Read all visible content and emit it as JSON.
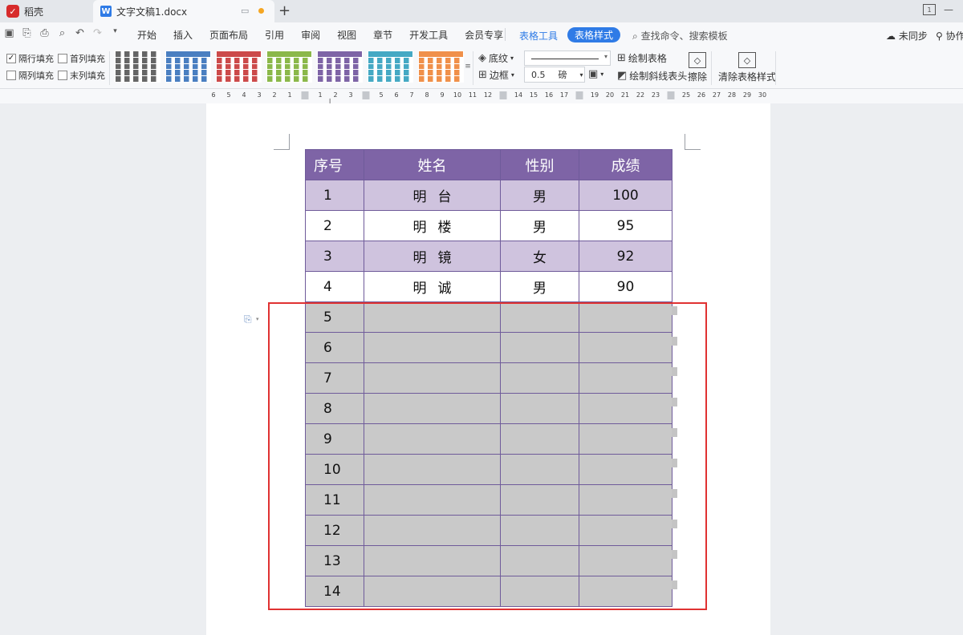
{
  "tabs": {
    "docer": {
      "label": "稻壳"
    },
    "document": {
      "label": "文字文稿1.docx"
    }
  },
  "menu": {
    "items": [
      "开始",
      "插入",
      "页面布局",
      "引用",
      "审阅",
      "视图",
      "章节",
      "开发工具",
      "会员专享"
    ],
    "context_tab": "表格工具",
    "active_tab": "表格样式",
    "search_placeholder": "查找命令、搜索模板",
    "sync_label": "未同步",
    "collab_label": "协作"
  },
  "ribbon": {
    "checkboxes": [
      {
        "label": "隔行填充",
        "checked": true
      },
      {
        "label": "首列填充",
        "checked": false
      },
      {
        "label": "隔列填充",
        "checked": false
      },
      {
        "label": "末列填充",
        "checked": false
      }
    ],
    "style_colors": [
      "#ffffff",
      "#4a7fc1",
      "#cc4a4a",
      "#8bb84a",
      "#7e64a6",
      "#45a9c4",
      "#f0904a"
    ],
    "shading_label": "底纹",
    "border_label": "边框",
    "line_weight": "0.5",
    "line_unit": "磅",
    "draw_table_label": "绘制表格",
    "draw_diagonal_label": "绘制斜线表头",
    "erase_label": "擦除",
    "clear_style_label": "清除表格样式"
  },
  "ruler": {
    "labels": [
      "6",
      "5",
      "4",
      "3",
      "2",
      "1",
      "",
      "1",
      "2",
      "3",
      "",
      "5",
      "6",
      "7",
      "8",
      "9",
      "10",
      "11",
      "12",
      "",
      "14",
      "15",
      "16",
      "17",
      "",
      "19",
      "20",
      "21",
      "22",
      "23",
      "",
      "25",
      "26",
      "27",
      "28",
      "29",
      "30"
    ]
  },
  "table": {
    "headers": [
      "序号",
      "姓名",
      "性别",
      "成绩"
    ],
    "rows": [
      [
        "1",
        "明台",
        "男",
        "100"
      ],
      [
        "2",
        "明楼",
        "男",
        "95"
      ],
      [
        "3",
        "明镜",
        "女",
        "92"
      ],
      [
        "4",
        "明诚",
        "男",
        "90"
      ],
      [
        "5",
        "",
        "",
        ""
      ],
      [
        "6",
        "",
        "",
        ""
      ],
      [
        "7",
        "",
        "",
        ""
      ],
      [
        "8",
        "",
        "",
        ""
      ],
      [
        "9",
        "",
        "",
        ""
      ],
      [
        "10",
        "",
        "",
        ""
      ],
      [
        "11",
        "",
        "",
        ""
      ],
      [
        "12",
        "",
        "",
        ""
      ],
      [
        "13",
        "",
        "",
        ""
      ],
      [
        "14",
        "",
        "",
        ""
      ]
    ]
  },
  "colors": {
    "header_fill": "#7e64a6",
    "band_fill": "#cfc3de",
    "selected_fill": "#c9c9c9",
    "highlight_border": "#e03232",
    "accent": "#2f7be6"
  }
}
